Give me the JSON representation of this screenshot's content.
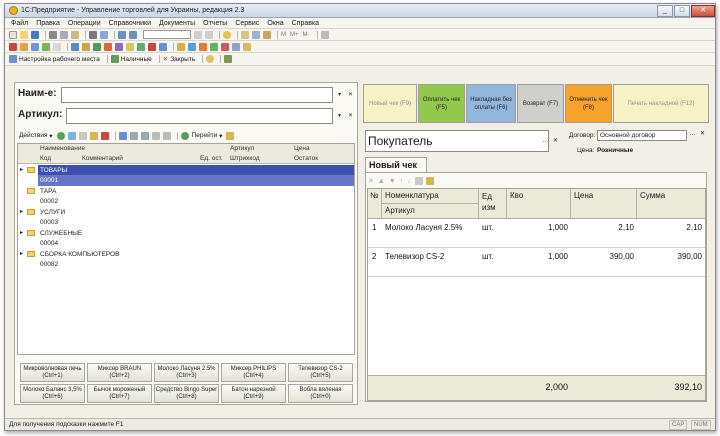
{
  "title": "1С:Предприятие - Управление торговлей для Украины, редакция 2.3",
  "menu": [
    "Файл",
    "Правка",
    "Операции",
    "Справочники",
    "Документы",
    "Отчеты",
    "Сервис",
    "Окна",
    "Справка"
  ],
  "toolbar3": {
    "workplace": "Настройка рабочего места",
    "cash": "Наличные",
    "close": "Закрыть"
  },
  "toolbar_m": [
    "M",
    "M+",
    "M-"
  ],
  "left": {
    "name_label": "Наим-е:",
    "article_label": "Артикул:",
    "actions": "Действия",
    "goto": "Перейти",
    "headers": {
      "name": "Наименование",
      "code": "Код",
      "comment": "Комментарий",
      "unit": "Ед. ост.",
      "article": "Артикул",
      "barcode": "Штрихкод",
      "price": "Цена",
      "stock": "Остаток"
    },
    "groups": [
      {
        "name": "ТОВАРЫ",
        "code": "00001"
      },
      {
        "name": "ТАРА",
        "code": "00002"
      },
      {
        "name": "УСЛУГИ",
        "code": "00003"
      },
      {
        "name": "СЛУЖЕБНЫЕ",
        "code": "00004"
      },
      {
        "name": "СБОРКА КОМПЬЮТЕРОВ",
        "code": "00082"
      }
    ],
    "quick": [
      [
        "Микроволновая печь",
        "(Ctrl+1)"
      ],
      [
        "Миксер BRAUN",
        "(Ctrl+2)"
      ],
      [
        "Молоко Ласуня 2.5%",
        "(Ctrl+3)"
      ],
      [
        "Миксер PHILIPS",
        "(Ctrl+4)"
      ],
      [
        "Телевизор CS-2",
        "(Ctrl+5)"
      ],
      [
        "Молоко Баланс 3,5%",
        "(Ctrl+6)"
      ],
      [
        "Бычок мороженый",
        "(Ctrl+7)"
      ],
      [
        "Средство Bingo Super",
        "(Ctrl+8)"
      ],
      [
        "Батон нарезной",
        "(Ctrl+9)"
      ],
      [
        "Вобла вяленая",
        "(Ctrl+0)"
      ]
    ]
  },
  "right": {
    "fbuttons": [
      {
        "label": "Новый чек (F9)",
        "color": "#f6f2c6",
        "text": "#999488"
      },
      {
        "label": "Оплатить чек (F5)",
        "color": "#92c94a",
        "text": "#222"
      },
      {
        "label": "Накладная без оплаты (F6)",
        "color": "#93b6dd",
        "text": "#222"
      },
      {
        "label": "Возврат (F7)",
        "color": "#cfcfcb",
        "text": "#222"
      },
      {
        "label": "Отменить чек (F8)",
        "color": "#f6a22b",
        "text": "#222"
      },
      {
        "label": "Печать накладной (F12)",
        "color": "#f6f2c6",
        "text": "#999488"
      }
    ],
    "buyer_label": "Покупатель",
    "contract_label": "Договор:",
    "contract_value": "Основной договор",
    "price_label": "Цена:",
    "price_value": "Розничные",
    "tab": "Новый чек",
    "headers": {
      "num": "№",
      "nomen": "Номенклатура",
      "article": "Артикул",
      "unit": "Ед изм",
      "qty": "Кво",
      "price": "Цена",
      "sum": "Сумма"
    },
    "rows": [
      {
        "num": "1",
        "name": "Молоко Ласуня 2.5%",
        "unit": "шт.",
        "qty": "1,000",
        "price": "2,10",
        "sum": "2,10"
      },
      {
        "num": "2",
        "name": "Телевизор CS-2",
        "unit": "шт.",
        "qty": "1,000",
        "price": "390,00",
        "sum": "390,00"
      }
    ],
    "total_qty": "2,000",
    "total_sum": "392,10"
  },
  "status": {
    "hint": "Для получения подсказки нажмите F1",
    "cap": "CAP",
    "num": "NUM"
  }
}
